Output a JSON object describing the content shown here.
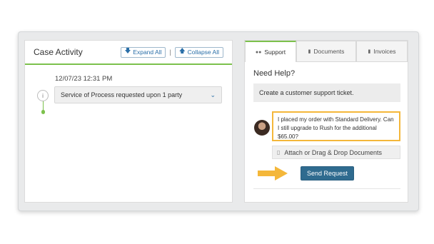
{
  "case_activity": {
    "title": "Case Activity",
    "expand_label": "Expand All",
    "collapse_label": "Collapse All",
    "separator": "|",
    "expand_icon": "arrow-down-icon",
    "collapse_icon": "arrow-up-icon",
    "events": [
      {
        "date": "12/07/23 12:31 PM",
        "text": "Service of Process requested upon 1 party",
        "icon": "info-icon"
      }
    ]
  },
  "support": {
    "tabs": [
      {
        "label": "Support",
        "icon": "people-icon",
        "active": true
      },
      {
        "label": "Documents",
        "icon": "document-icon",
        "active": false
      },
      {
        "label": "Invoices",
        "icon": "invoice-icon",
        "active": false
      }
    ],
    "need_help": "Need Help?",
    "ticket_label": "Create a customer support ticket.",
    "message": "I placed my order with Standard Delivery. Can I still upgrade to Rush for the additional $65.00?",
    "attach_label": "Attach or Drag & Drop Documents",
    "send_label": "Send Request"
  },
  "colors": {
    "accent_green": "#7cc14c",
    "button_blue": "#2f6b8f",
    "highlight_orange": "#f4b73a"
  }
}
